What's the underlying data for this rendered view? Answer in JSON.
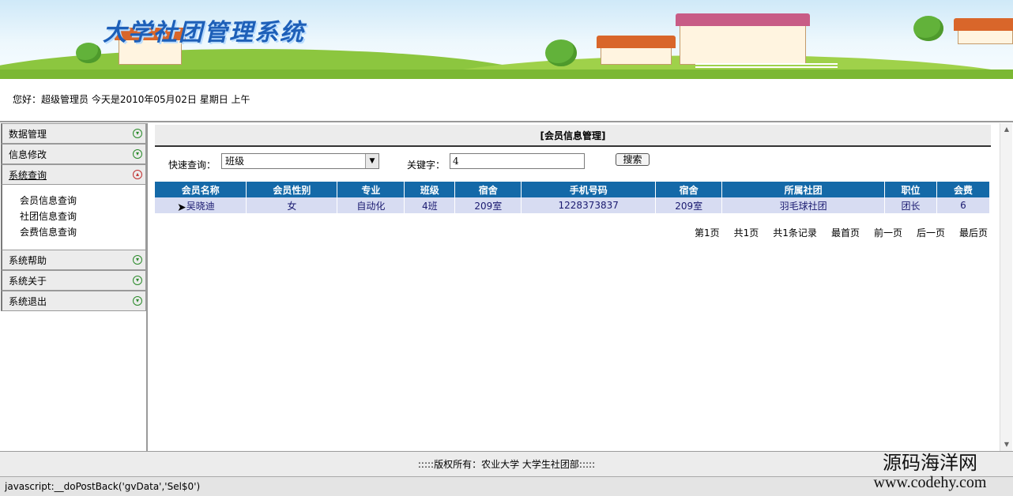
{
  "banner": {
    "title": "大学社团管理系统"
  },
  "greeting": {
    "text": "您好：超级管理员   今天是2010年05月02日   星期日   上午"
  },
  "sidebar": {
    "items": [
      {
        "label": "数据管理",
        "icon": "expand-icon"
      },
      {
        "label": "信息修改",
        "icon": "expand-icon"
      },
      {
        "label": "系统查询",
        "icon": "collapse-icon"
      },
      {
        "label": "系统帮助",
        "icon": "expand-icon"
      },
      {
        "label": "系统关于",
        "icon": "expand-icon"
      },
      {
        "label": "系统退出",
        "icon": "expand-icon"
      }
    ],
    "submenu": [
      "会员信息查询",
      "社团信息查询",
      "会费信息查询"
    ]
  },
  "panel": {
    "title": "[会员信息管理]",
    "quick_label": "快速查询：",
    "quick_value": "班级",
    "keyword_label": "关键字：",
    "keyword_value": "4",
    "search_button": "搜索"
  },
  "table": {
    "headers": [
      "会员名称",
      "会员性别",
      "专业",
      "班级",
      "宿舍",
      "手机号码",
      "宿舍",
      "所属社团",
      "职位",
      "会费"
    ],
    "rows": [
      [
        "吴晓迪",
        "女",
        "自动化",
        "4班",
        "209室",
        "1228373837",
        "209室",
        "羽毛球社团",
        "团长",
        "6"
      ]
    ]
  },
  "pager": {
    "page": "第1页",
    "total_pages": "共1页",
    "total_records": "共1条记录",
    "first": "最首页",
    "prev": "前一页",
    "next": "后一页",
    "last": "最后页"
  },
  "footer": {
    "text": ":::::版权所有：农业大学  大学生社团部:::::"
  },
  "status": {
    "text": "javascript:__doPostBack('gvData','Sel$0')"
  },
  "watermark": {
    "cn": "源码海洋网",
    "en": "www.codehy.com"
  },
  "colors": {
    "header_blue": "#1469a8",
    "row_bg": "#d7dcf2",
    "page_red": "#c03030"
  }
}
